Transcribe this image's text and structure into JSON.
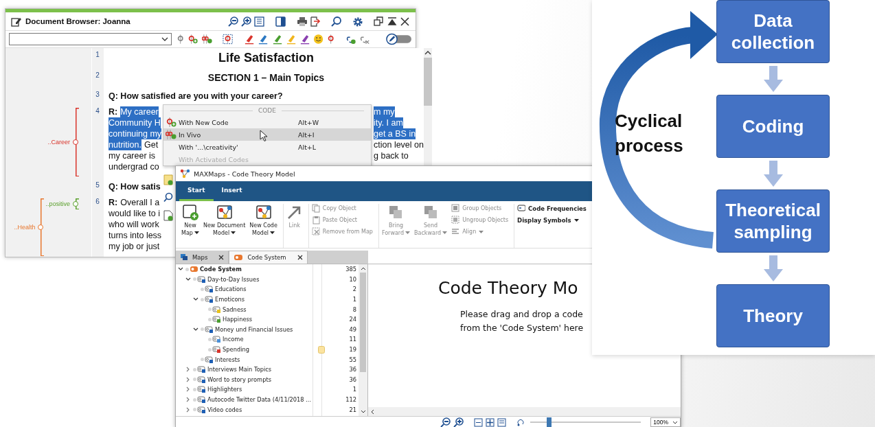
{
  "document_browser": {
    "title": "Document Browser: Joanna",
    "paragraphs": [
      {
        "number": "1",
        "kind": "title",
        "lines": [
          {
            "left": [
              {
                "text": "Life Satisfaction",
                "kind": "plain",
                "selected": false
              }
            ]
          }
        ]
      },
      {
        "number": "2",
        "kind": "heading",
        "lines": [
          {
            "left": [
              {
                "text": "SECTION 1 – Main Topics",
                "kind": "plain",
                "selected": false
              }
            ]
          }
        ]
      },
      {
        "number": "3",
        "kind": "question",
        "lines": [
          {
            "left": [
              {
                "text": "Q: How satisfied are you with your career?",
                "kind": "plain",
                "selected": false
              }
            ]
          }
        ]
      },
      {
        "number": "4",
        "kind": "answer",
        "codes": [
          {
            "label": "..Career",
            "color": "#d9342b",
            "kind": "whole"
          }
        ],
        "lines": [
          {
            "left": [
              {
                "text": "R:",
                "kind": "speaker",
                "selected": false
              },
              {
                "text": "My career",
                "kind": "plain",
                "selected": true
              }
            ],
            "right": [
              {
                "text": "m my",
                "kind": "plain",
                "selected": true
              }
            ]
          },
          {
            "left": [
              {
                "text": "Community H",
                "kind": "plain",
                "selected": true
              }
            ],
            "right": [
              {
                "text": "ity. I am",
                "kind": "plain",
                "selected": true
              }
            ]
          },
          {
            "left": [
              {
                "text": "continuing my",
                "kind": "plain",
                "selected": true
              }
            ],
            "right": [
              {
                "text": "get a BS in",
                "kind": "plain",
                "selected": true
              }
            ]
          },
          {
            "left": [
              {
                "text": "nutrition.",
                "kind": "plain",
                "selected": true
              },
              {
                "text": "Get",
                "kind": "plain",
                "selected": false
              }
            ],
            "right": [
              {
                "text": "ction level on",
                "kind": "plain",
                "selected": false
              }
            ]
          },
          {
            "left": [
              {
                "text": "my career is",
                "kind": "plain",
                "selected": false
              }
            ],
            "right": [
              {
                "text": "g back to",
                "kind": "plain",
                "selected": false
              }
            ]
          },
          {
            "left": [
              {
                "text": "undergrad co",
                "kind": "plain",
                "selected": false
              }
            ]
          }
        ]
      },
      {
        "number": "5",
        "kind": "question",
        "lines": [
          {
            "left": [
              {
                "text": "Q: How satis",
                "kind": "plain",
                "selected": false
              }
            ]
          }
        ]
      },
      {
        "number": "6",
        "kind": "answer",
        "codes": [
          {
            "label": "..positive",
            "color": "#5aa02c",
            "kind": "partial"
          },
          {
            "label": "..Health",
            "color": "#e8772e",
            "kind": "whole"
          }
        ],
        "lines": [
          {
            "left": [
              {
                "text": "R:",
                "kind": "speaker",
                "selected": false
              },
              {
                "text": "Overall I a",
                "kind": "plain",
                "selected": false
              }
            ]
          },
          {
            "left": [
              {
                "text": "would like to i",
                "kind": "plain",
                "selected": false
              }
            ]
          },
          {
            "left": [
              {
                "text": "who will work",
                "kind": "plain",
                "selected": false
              }
            ]
          },
          {
            "left": [
              {
                "text": "turns into less",
                "kind": "plain",
                "selected": false
              }
            ]
          },
          {
            "left": [
              {
                "text": "my job or just",
                "kind": "plain",
                "selected": false
              }
            ]
          }
        ]
      }
    ]
  },
  "context_menu": {
    "header": "CODE",
    "items": [
      {
        "label": "With New Code",
        "shortcut": "Alt+W",
        "selected": false,
        "disabled": false
      },
      {
        "label": "In Vivo",
        "shortcut": "Alt+I",
        "selected": true,
        "disabled": false
      },
      {
        "label": "With '...\\creativity'",
        "shortcut": "Alt+L",
        "selected": false,
        "disabled": false
      },
      {
        "label": "With Activated Codes",
        "selected": false,
        "disabled": true
      }
    ]
  },
  "maxmaps": {
    "title": "MAXMaps - Code Theory Model",
    "ribbon_tabs": [
      {
        "label": "Start",
        "selected": true
      },
      {
        "label": "Insert",
        "selected": false
      }
    ],
    "ribbon_groups": [
      {
        "items": [
          {
            "kind": "large",
            "lines": [
              "New",
              "Map"
            ],
            "dropdown": true,
            "disabled": false
          },
          {
            "kind": "large",
            "lines": [
              "New Document",
              "Model"
            ],
            "dropdown": true,
            "disabled": false
          },
          {
            "kind": "large",
            "lines": [
              "New Code",
              "Model"
            ],
            "dropdown": true,
            "disabled": false
          }
        ]
      },
      {
        "items": [
          {
            "kind": "large",
            "lines": [
              "Link"
            ],
            "dropdown": false,
            "disabled": true
          }
        ]
      },
      {
        "items": [
          {
            "kind": "small",
            "lines": [
              "Copy Object"
            ],
            "dropdown": false,
            "disabled": true
          },
          {
            "kind": "small",
            "lines": [
              "Paste Object"
            ],
            "dropdown": false,
            "disabled": true
          },
          {
            "kind": "small",
            "lines": [
              "Remove from Map"
            ],
            "dropdown": false,
            "disabled": true
          }
        ]
      },
      {
        "items": [
          {
            "kind": "large",
            "lines": [
              "Bring",
              "Forward"
            ],
            "dropdown": true,
            "disabled": true
          },
          {
            "kind": "large",
            "lines": [
              "Send",
              "Backward"
            ],
            "dropdown": true,
            "disabled": true
          },
          {
            "kind": "stack",
            "items": [
              {
                "label": "Group Objects",
                "dropdown": false,
                "disabled": true
              },
              {
                "label": "Ungroup Objects",
                "dropdown": false,
                "disabled": true
              },
              {
                "label": "Align",
                "dropdown": true,
                "disabled": true
              }
            ]
          }
        ]
      },
      {
        "items": [
          {
            "kind": "small",
            "lines": [
              "Code Frequencies"
            ],
            "dropdown": false,
            "disabled": false
          },
          {
            "kind": "small",
            "lines": [
              "Display Symbols"
            ],
            "dropdown": true,
            "disabled": false
          }
        ]
      }
    ],
    "panel_tabs": [
      {
        "label": "Maps",
        "selected": false
      },
      {
        "label": "Code System",
        "selected": true
      }
    ],
    "code_tree": {
      "label": "Code System",
      "count": "385",
      "kind": "root",
      "expanded": true,
      "children": [
        {
          "label": "Day-to-Day Issues",
          "count": "10",
          "color": "#1e5fb4",
          "kind": "group",
          "expanded": true,
          "memo": false,
          "children": [
            {
              "label": "Educations",
              "count": "2",
              "color": "#1e5fb4",
              "kind": "leaf",
              "memo": false
            },
            {
              "label": "Emoticons",
              "count": "1",
              "color": "#1e5fb4",
              "kind": "group",
              "expanded": true,
              "memo": false,
              "children": [
                {
                  "label": "Sadness",
                  "count": "8",
                  "color": "#e8c21c",
                  "kind": "leaf",
                  "memo": false
                },
                {
                  "label": "Happiness",
                  "count": "24",
                  "color": "#4a9e2f",
                  "kind": "leaf",
                  "memo": false
                }
              ]
            },
            {
              "label": "Money und Financial Issues",
              "count": "49",
              "color": "#1e5fb4",
              "kind": "group",
              "expanded": true,
              "memo": false,
              "children": [
                {
                  "label": "Income",
                  "count": "11",
                  "color": "#4a90d9",
                  "kind": "leaf",
                  "memo": false
                },
                {
                  "label": "Spending",
                  "count": "19",
                  "color": "#d9342b",
                  "kind": "leaf",
                  "memo": true
                }
              ]
            },
            {
              "label": "Interests",
              "count": "55",
              "color": "#1e5fb4",
              "kind": "leaf",
              "memo": false
            }
          ]
        },
        {
          "label": "Interviews Main Topics",
          "count": "36",
          "color": "#1e5fb4",
          "kind": "group",
          "expanded": false,
          "memo": false
        },
        {
          "label": "Word to story prompts",
          "count": "36",
          "color": "#1e5fb4",
          "kind": "group",
          "expanded": false,
          "memo": false
        },
        {
          "label": "Highlighters",
          "count": "1",
          "color": "#1e5fb4",
          "kind": "group",
          "expanded": false,
          "memo": false
        },
        {
          "label": "Autocode Twitter Data (4/11/2018 ...",
          "count": "112",
          "color": "#1e5fb4",
          "kind": "group",
          "expanded": false,
          "memo": false
        },
        {
          "label": "Video codes",
          "count": "21",
          "color": "#1e5fb4",
          "kind": "group",
          "expanded": false,
          "memo": false
        }
      ]
    },
    "canvas": {
      "heading": "Code Theory Mo",
      "hint_lines": [
        "Please drag and drop a code",
        "from the 'Code System' here"
      ]
    },
    "zoom_slider": {
      "level": 0.15
    },
    "zoom_value": "100%"
  },
  "diagram": {
    "steps": [
      "Data collection",
      "Coding",
      "Theoretical sampling",
      "Theory"
    ],
    "cycle_label": [
      "Cyclical",
      "process"
    ]
  }
}
